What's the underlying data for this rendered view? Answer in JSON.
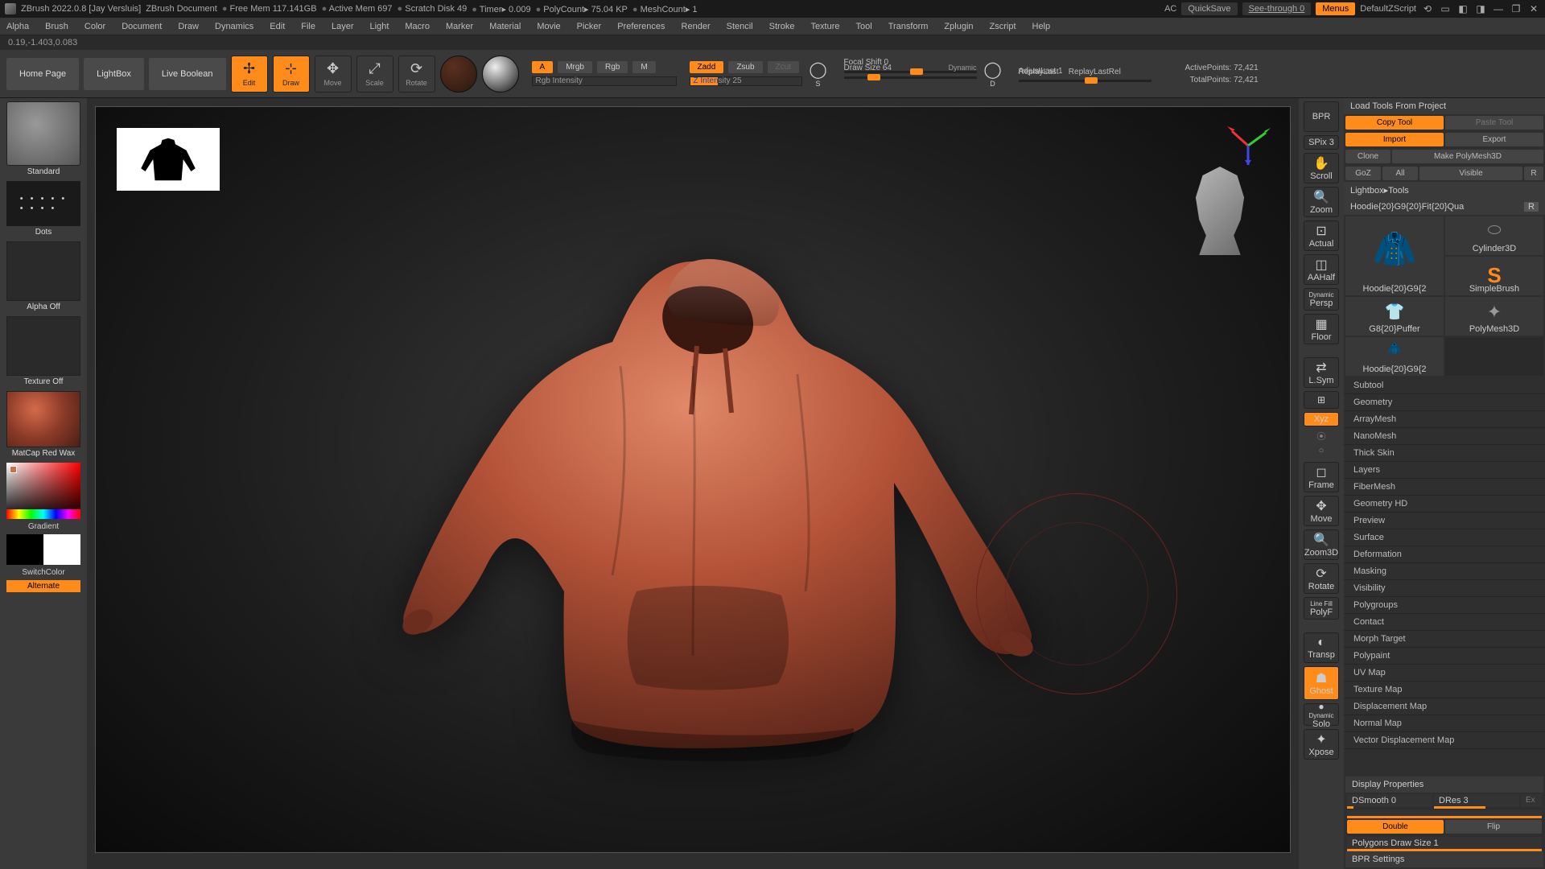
{
  "title": {
    "app": "ZBrush 2022.0.8 [Jay Versluis]",
    "doc": "ZBrush Document",
    "mem": "Free Mem 117.141GB",
    "active": "Active Mem 697",
    "scratch": "Scratch Disk 49",
    "timer": "Timer▸ 0.009",
    "poly": "PolyCount▸ 75.04 KP",
    "mesh": "MeshCount▸ 1",
    "ac": "AC",
    "quicksave": "QuickSave",
    "seethrough": "See-through  0",
    "menus": "Menus",
    "script": "DefaultZScript"
  },
  "menus": [
    "Alpha",
    "Brush",
    "Color",
    "Document",
    "Draw",
    "Dynamics",
    "Edit",
    "File",
    "Layer",
    "Light",
    "Macro",
    "Marker",
    "Material",
    "Movie",
    "Picker",
    "Preferences",
    "Render",
    "Stencil",
    "Stroke",
    "Texture",
    "Tool",
    "Transform",
    "Zplugin",
    "Zscript",
    "Help"
  ],
  "coord": "0.19,-1.403,0.083",
  "toolbar": {
    "home": "Home Page",
    "lightbox": "LightBox",
    "live": "Live Boolean",
    "edit": "Edit",
    "draw": "Draw",
    "move": "Move",
    "scale": "Scale",
    "rotate": "Rotate",
    "a": "A",
    "mrgb": "Mrgb",
    "rgb": "Rgb",
    "m": "M",
    "rgbint": "Rgb Intensity",
    "zadd": "Zadd",
    "zsub": "Zsub",
    "zcut": "Zcut",
    "zint": "Z Intensity 25",
    "focal": "Focal Shift 0",
    "drawsize": "Draw Size 64",
    "dynamic": "Dynamic",
    "replay": "ReplayLast",
    "replayrel": "ReplayLastRel",
    "adjust": "AdjustLast 1",
    "activepts": "ActivePoints: 72,421",
    "totalpts": "TotalPoints: 72,421",
    "s": "S",
    "d": "D"
  },
  "left": {
    "standard": "Standard",
    "dots": "Dots",
    "alphaoff": "Alpha Off",
    "texoff": "Texture Off",
    "mat": "MatCap Red Wax",
    "gradient": "Gradient",
    "switch": "SwitchColor",
    "alternate": "Alternate"
  },
  "rtool": {
    "bpr": "BPR",
    "spix": "SPix 3",
    "scroll": "Scroll",
    "zoom": "Zoom",
    "actual": "Actual",
    "aahalf": "AAHalf",
    "persp": "Persp",
    "floor": "Floor",
    "lsym": "L.Sym",
    "xyz": "Xyz",
    "frame": "Frame",
    "move": "Move",
    "zoom3d": "Zoom3D",
    "rotate": "Rotate",
    "linefill": "Line Fill",
    "polyf": "PolyF",
    "transp": "Transp",
    "ghost": "Ghost",
    "solo": "Solo",
    "xpose": "Xpose",
    "dynamic": "Dynamic"
  },
  "right": {
    "loadtools": "Load Tools From Project",
    "copy": "Copy Tool",
    "paste": "Paste Tool",
    "import": "Import",
    "export": "Export",
    "clone": "Clone",
    "makepoly": "Make PolyMesh3D",
    "goz": "GoZ",
    "all": "All",
    "visible": "Visible",
    "r": "R",
    "lightbox": "Lightbox▸Tools",
    "toolname": "Hoodie{20}G9{20}Fit{20}Qua",
    "r2": "R",
    "tools": [
      "Hoodie{20}G9{2",
      "Cylinder3D",
      "SimpleBrush",
      "G8{20}Puffer",
      "PolyMesh3D",
      "Hoodie{20}G9{2"
    ],
    "sections": [
      "Subtool",
      "Geometry",
      "ArrayMesh",
      "NanoMesh",
      "Thick Skin",
      "Layers",
      "FiberMesh",
      "Geometry HD",
      "Preview",
      "Surface",
      "Deformation",
      "Masking",
      "Visibility",
      "Polygroups",
      "Contact",
      "Morph Target",
      "Polypaint",
      "UV Map",
      "Texture Map",
      "Displacement Map",
      "Normal Map",
      "Vector Displacement Map"
    ],
    "display": "Display Properties",
    "dsmooth": "DSmooth 0",
    "dres": "DRes 3",
    "ex": "Ex",
    "double": "Double",
    "flip": "Flip",
    "polysize": "Polygons Draw Size 1",
    "bpr": "BPR Settings"
  }
}
